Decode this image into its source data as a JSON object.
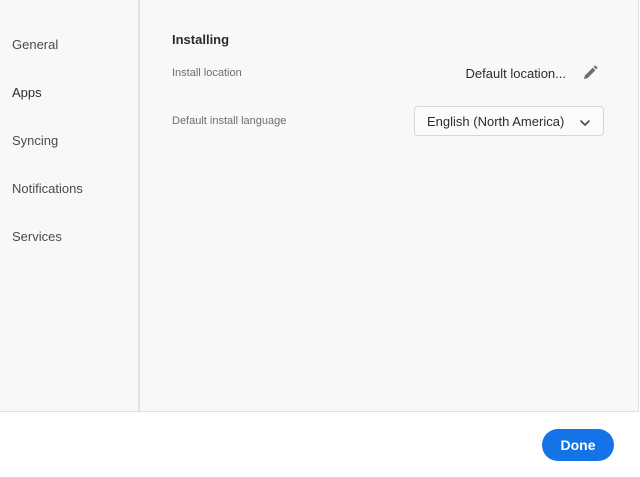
{
  "sidebar": {
    "items": [
      {
        "label": "General"
      },
      {
        "label": "Apps"
      },
      {
        "label": "Syncing"
      },
      {
        "label": "Notifications"
      },
      {
        "label": "Services"
      }
    ],
    "active": "Apps"
  },
  "installing": {
    "section_title": "Installing",
    "install_location_label": "Install location",
    "install_location_value": "Default location...",
    "edit_icon": "pencil-icon",
    "language_label": "Default install language",
    "language_value": "English (North America)",
    "dropdown_icon": "chevron-down-icon"
  },
  "footer": {
    "done_label": "Done"
  },
  "colors": {
    "accent": "#1473e6",
    "panel_bg": "#f8f8f8"
  }
}
